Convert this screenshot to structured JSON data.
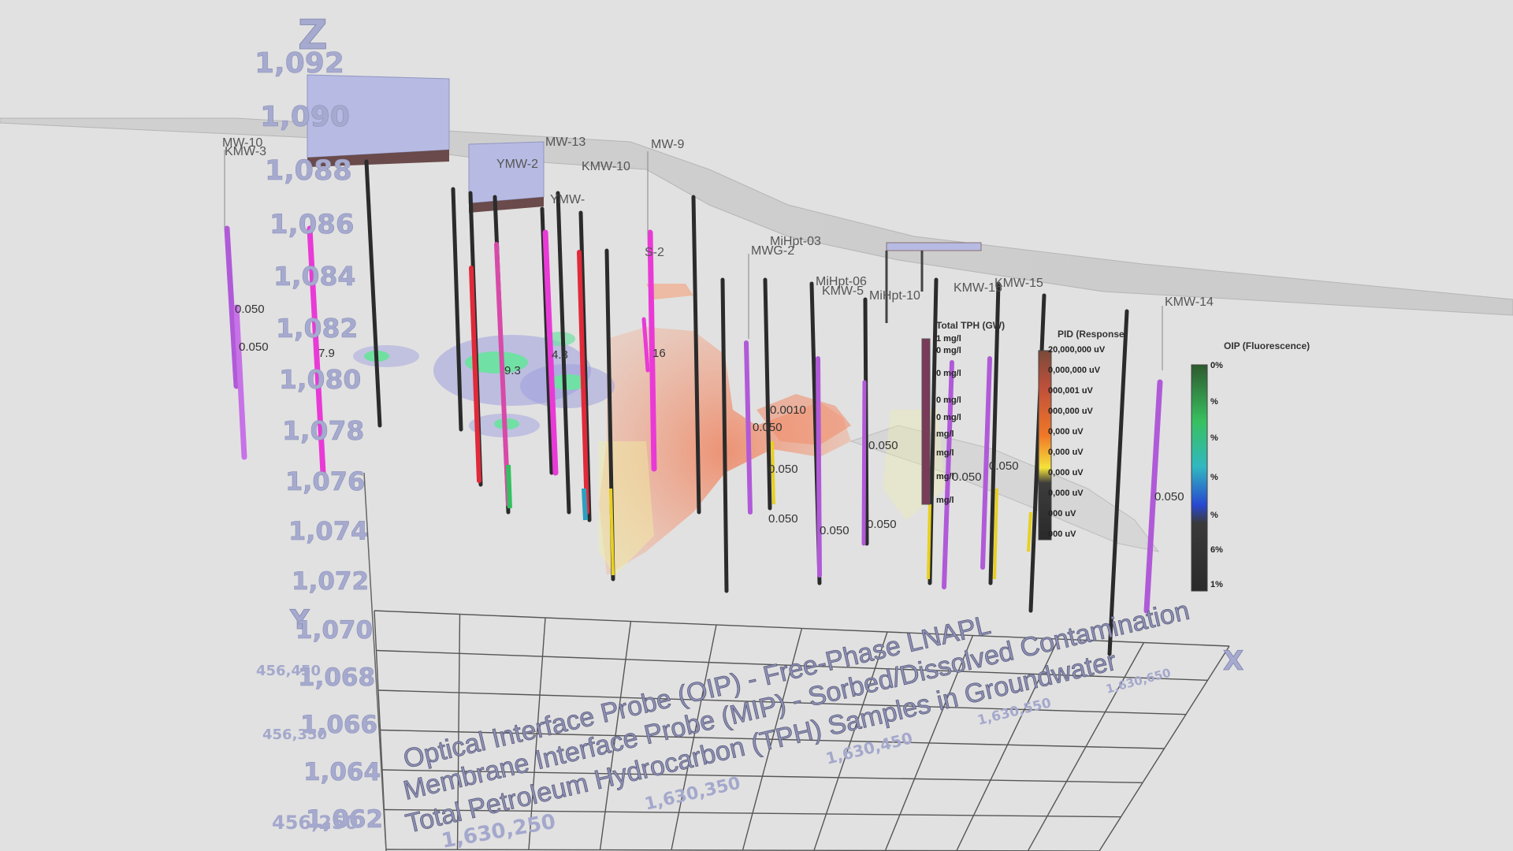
{
  "axes": {
    "z_letter": "Z",
    "y_letter": "Y",
    "x_letter": "X",
    "z_ticks": [
      "1,092",
      "1,090",
      "1,088",
      "1,086",
      "1,084",
      "1,082",
      "1,080",
      "1,078",
      "1,076",
      "1,074",
      "1,072",
      "1,070",
      "1,068",
      "1,066",
      "1,064",
      "1,062"
    ],
    "y_ticks": [
      "456,450",
      "456,350",
      "456,250"
    ],
    "x_ticks": [
      "1,630,250",
      "1,630,350",
      "1,630,450",
      "1,630,550",
      "1,630,650"
    ]
  },
  "wells": [
    {
      "name": "MW-10"
    },
    {
      "name": "KMW-3"
    },
    {
      "name": "MW-13"
    },
    {
      "name": "YMW-2"
    },
    {
      "name": "KMW-10"
    },
    {
      "name": "MW-9"
    },
    {
      "name": "YMW-"
    },
    {
      "name": "S-2"
    },
    {
      "name": "MiHpt-03"
    },
    {
      "name": "MWG-2"
    },
    {
      "name": "MiHpt-06"
    },
    {
      "name": "KMW-5"
    },
    {
      "name": "MiHpt-10"
    },
    {
      "name": "KMW-16"
    },
    {
      "name": "KMW-15"
    },
    {
      "name": "KMW-14"
    }
  ],
  "values": [
    "0.050",
    "0.050",
    "7.9",
    "9.3",
    "4.3",
    "16",
    "0.0010",
    "0.050",
    "0.050",
    "0.050",
    "0.050",
    "0.050",
    "0.050",
    "0.050",
    "0.050",
    "0.050"
  ],
  "legends": {
    "tph": {
      "title": "Total TPH (GW)",
      "items": [
        "1 mg/l",
        "0 mg/l",
        "0 mg/l",
        "0 mg/l",
        "0 mg/l",
        "mg/l",
        "mg/l",
        "mg/l",
        "mg/l"
      ]
    },
    "pid": {
      "title": "PID (Response)",
      "items": [
        "20,000,000 uV",
        "0,000,000 uV",
        "000,001 uV",
        "000,000 uV",
        "0,000 uV",
        "0,000 uV",
        "0,000 uV",
        "0,000 uV",
        "000 uV",
        "000 uV"
      ]
    },
    "oip": {
      "title": "OIP (Fluorescence)",
      "items": [
        "0%",
        "%",
        "%",
        "%",
        "%",
        "%",
        "6%",
        "1%"
      ]
    }
  },
  "captions": [
    "Optical Interface Probe (OIP) - Free-Phase LNAPL",
    "Membrane Interface Probe (MIP) - Sorbed/Dissolved Contamination",
    "Total Petroleum Hydrocarbon (TPH) Samples in Groundwater"
  ],
  "colors": {
    "background": "#e1e1e1",
    "axis_text": "#a6aacf",
    "well_casing": "#2b2b2b",
    "screen_violet": "#b05ad8",
    "screen_magenta": "#e93ad6",
    "screen_red": "#e02a3a",
    "plume": "#f08060",
    "free_phase": "#7ee3a8"
  }
}
